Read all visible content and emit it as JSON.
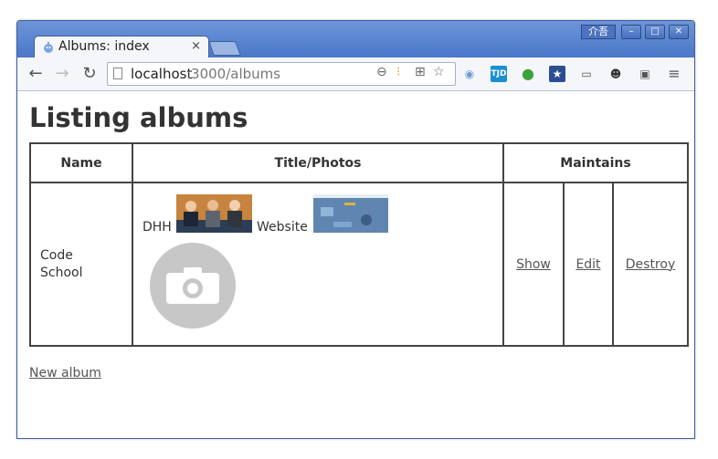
{
  "browser": {
    "tab_title": "Albums: index",
    "tab_close": "×",
    "ime_label": "介吾",
    "url_host": "localhost",
    "url_path": ":3000/albums"
  },
  "page": {
    "heading": "Listing albums",
    "table": {
      "headers": [
        "Name",
        "Title/Photos",
        "Maintains"
      ],
      "rows": [
        {
          "name": "Code School",
          "photo_titles": [
            "DHH",
            "Website"
          ],
          "actions": [
            "Show",
            "Edit",
            "Destroy"
          ]
        }
      ]
    },
    "new_album_link": "New album"
  },
  "colors": {
    "titlebar": "#4a77c8",
    "link": "#555555",
    "text": "#333333"
  }
}
